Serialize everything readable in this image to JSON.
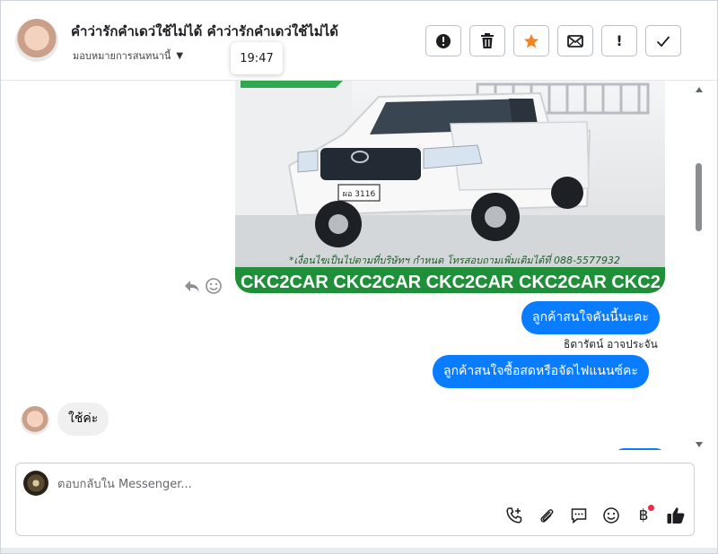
{
  "header": {
    "title": "คำว่ารักคำเดว่ใช้ไม่ได้ คำว่ารักคำเดว่ใช้ไม่ได้",
    "assign_label": "มอบหมายการสนทนานี้",
    "toolbar": {
      "spam": "alert-icon",
      "delete": "trash-icon",
      "star": "star-icon",
      "mark_unread": "envelope-icon",
      "follow_up": "!",
      "done": "check-icon"
    }
  },
  "tooltip": {
    "time": "19:47"
  },
  "messages": {
    "image_caption": "*เงื่อนไขเป็นไปตามที่บริษัทฯ กำหนด โทรสอบถามเพิ่มเติมได้ที่ 088-5577932",
    "image_brand": "CKC2CAR CKC2CAR CKC2CAR CKC2CAR CKC2",
    "plate": "ผอ 3116",
    "out_1": "ลูกค้าสนใจคันนี้นะคะ",
    "sender_name": "ธิดารัตน์ อาจประจัน",
    "out_2": "ลูกค้าสนใจซื้อสดหรือจัดไฟแนนซ์คะ",
    "in_1": "ใช้ค่ะ"
  },
  "composer": {
    "placeholder": "ตอบกลับใน Messenger...",
    "tools": [
      "call-add-icon",
      "paperclip-icon",
      "saved-reply-icon",
      "emoji-icon",
      "baht-icon",
      "thumbs-up-icon"
    ]
  },
  "colors": {
    "accent_blue": "#0a7cff",
    "star_orange": "#f5831f",
    "incoming_bubble": "#f0f0f0",
    "notification_red": "#f02849"
  }
}
